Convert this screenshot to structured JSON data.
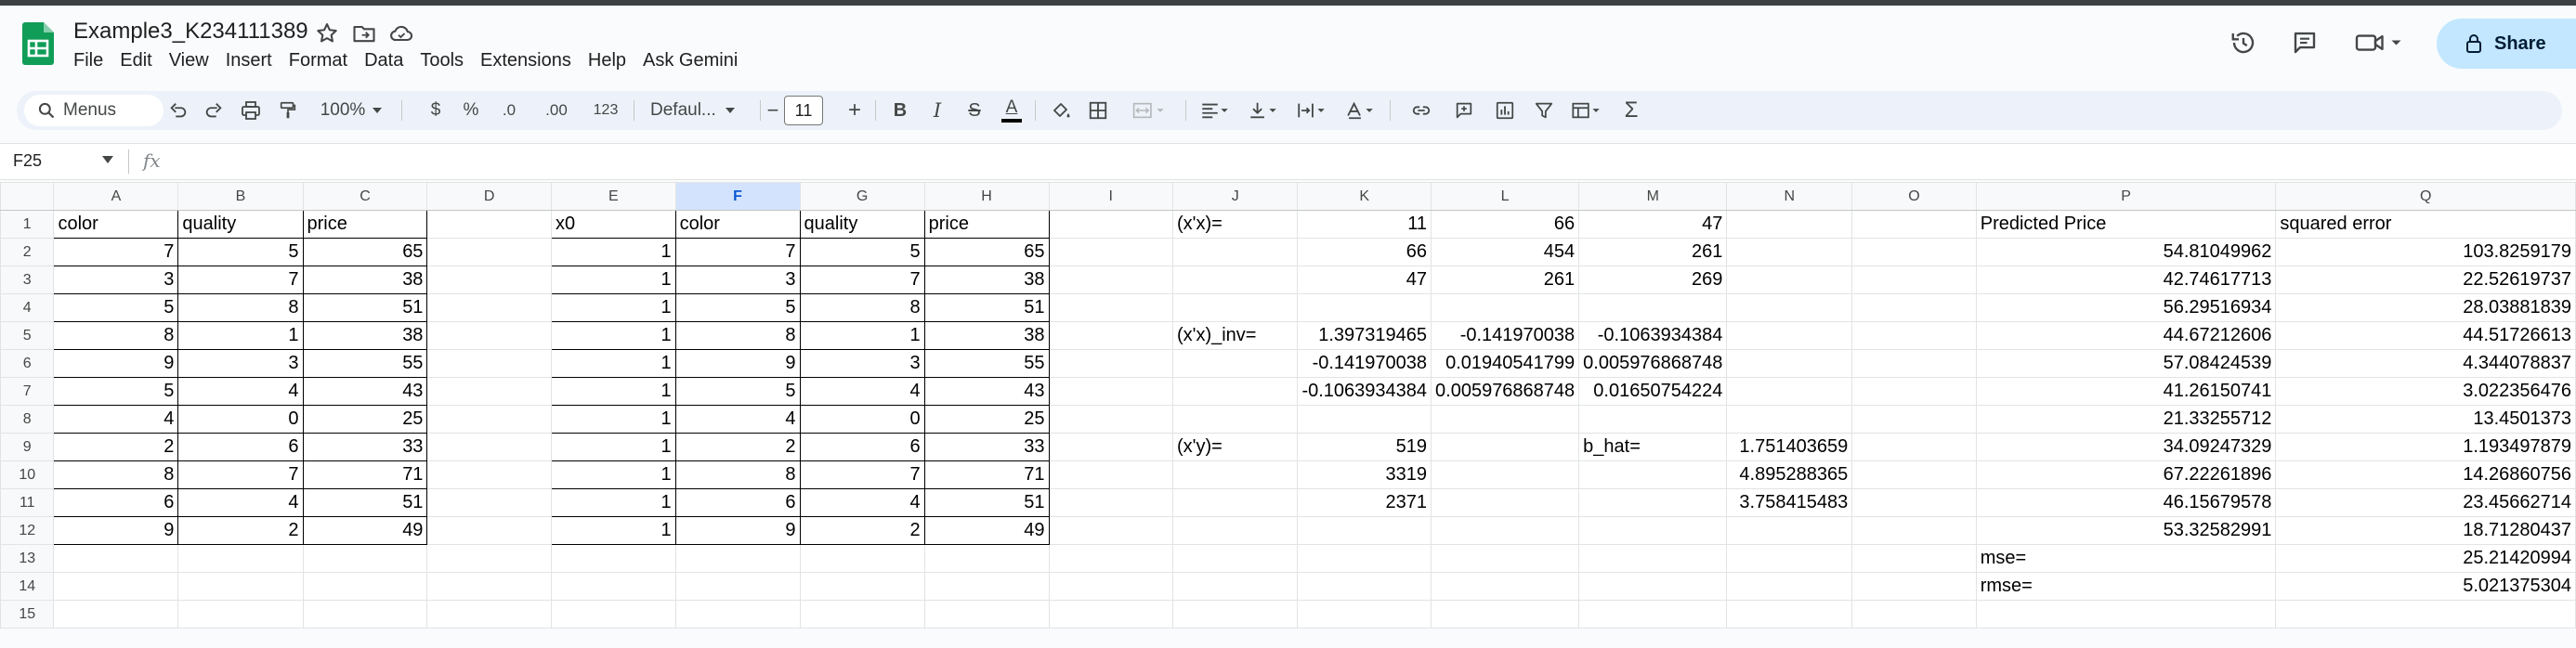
{
  "app": {
    "doc_title": "Example3_K234111389",
    "menu": [
      "File",
      "Edit",
      "View",
      "Insert",
      "Format",
      "Data",
      "Tools",
      "Extensions",
      "Help",
      "Ask Gemini"
    ],
    "share_label": "Share",
    "accent_color": "#0f9d58"
  },
  "toolbar": {
    "search_label": "Menus",
    "zoom": "100%",
    "currency": "$",
    "percent": "%",
    "dec_decrease": ".0",
    "dec_increase": ".00",
    "more_formats": "123",
    "font": "Defaul...",
    "font_size": "11",
    "minus": "−",
    "plus": "+",
    "bold": "B",
    "italic": "I",
    "strike": "S",
    "text_color": "A",
    "sigma": "Σ"
  },
  "formula_bar": {
    "cell_ref": "F25",
    "fx": "fx",
    "content": ""
  },
  "sheet": {
    "selected_column": "F",
    "columns": [
      "A",
      "B",
      "C",
      "D",
      "E",
      "F",
      "G",
      "H",
      "I",
      "J",
      "K",
      "L",
      "M",
      "N",
      "O",
      "P",
      "Q"
    ],
    "rows": [
      [
        "color",
        "quality",
        "price",
        "",
        "x0",
        "color",
        "quality",
        "price",
        "",
        "(x'x)=",
        "11",
        "66",
        "47",
        "",
        "",
        "Predicted Price",
        "squared error"
      ],
      [
        "7",
        "5",
        "65",
        "",
        "1",
        "7",
        "5",
        "65",
        "",
        "",
        "66",
        "454",
        "261",
        "",
        "",
        "54.81049962",
        "103.8259179"
      ],
      [
        "3",
        "7",
        "38",
        "",
        "1",
        "3",
        "7",
        "38",
        "",
        "",
        "47",
        "261",
        "269",
        "",
        "",
        "42.74617713",
        "22.52619737"
      ],
      [
        "5",
        "8",
        "51",
        "",
        "1",
        "5",
        "8",
        "51",
        "",
        "",
        "",
        "",
        "",
        "",
        "",
        "56.29516934",
        "28.03881839"
      ],
      [
        "8",
        "1",
        "38",
        "",
        "1",
        "8",
        "1",
        "38",
        "",
        "(x'x)_inv=",
        "1.397319465",
        "-0.141970038",
        "-0.1063934384",
        "",
        "",
        "44.67212606",
        "44.51726613"
      ],
      [
        "9",
        "3",
        "55",
        "",
        "1",
        "9",
        "3",
        "55",
        "",
        "",
        "-0.141970038",
        "0.01940541799",
        "0.005976868748",
        "",
        "",
        "57.08424539",
        "4.344078837"
      ],
      [
        "5",
        "4",
        "43",
        "",
        "1",
        "5",
        "4",
        "43",
        "",
        "",
        "-0.1063934384",
        "0.005976868748",
        "0.01650754224",
        "",
        "",
        "41.26150741",
        "3.022356476"
      ],
      [
        "4",
        "0",
        "25",
        "",
        "1",
        "4",
        "0",
        "25",
        "",
        "",
        "",
        "",
        "",
        "",
        "",
        "21.33255712",
        "13.4501373"
      ],
      [
        "2",
        "6",
        "33",
        "",
        "1",
        "2",
        "6",
        "33",
        "",
        "(x'y)=",
        "519",
        "",
        "b_hat=",
        "1.751403659",
        "",
        "34.09247329",
        "1.193497879"
      ],
      [
        "8",
        "7",
        "71",
        "",
        "1",
        "8",
        "7",
        "71",
        "",
        "",
        "3319",
        "",
        "",
        "4.895288365",
        "",
        "67.22261896",
        "14.26860756"
      ],
      [
        "6",
        "4",
        "51",
        "",
        "1",
        "6",
        "4",
        "51",
        "",
        "",
        "2371",
        "",
        "",
        "3.758415483",
        "",
        "46.15679578",
        "23.45662714"
      ],
      [
        "9",
        "2",
        "49",
        "",
        "1",
        "9",
        "2",
        "49",
        "",
        "",
        "",
        "",
        "",
        "",
        "",
        "53.32582991",
        "18.71280437"
      ],
      [
        "",
        "",
        "",
        "",
        "",
        "",
        "",
        "",
        "",
        "",
        "",
        "",
        "",
        "",
        "",
        "mse=",
        "25.21420994"
      ],
      [
        "",
        "",
        "",
        "",
        "",
        "",
        "",
        "",
        "",
        "",
        "",
        "",
        "",
        "",
        "",
        "rmse=",
        "5.021375304"
      ],
      [
        "",
        "",
        "",
        "",
        "",
        "",
        "",
        "",
        "",
        "",
        "",
        "",
        "",
        "",
        "",
        "",
        ""
      ]
    ]
  }
}
